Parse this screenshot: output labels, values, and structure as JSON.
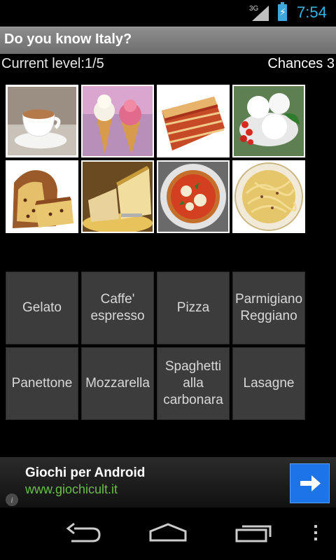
{
  "status_bar": {
    "network": "3G",
    "time": "7:54",
    "battery_icon": "battery-charging-icon",
    "signal_icon": "signal-icon"
  },
  "app": {
    "title": "Do you know Italy?"
  },
  "game": {
    "level_text": "Current level:1/5",
    "chances_text": "Chances 3",
    "images": [
      {
        "name": "espresso-cup-image"
      },
      {
        "name": "gelato-cones-image"
      },
      {
        "name": "lasagne-image"
      },
      {
        "name": "mozzarella-image"
      },
      {
        "name": "panettone-image"
      },
      {
        "name": "parmigiano-image"
      },
      {
        "name": "pizza-image"
      },
      {
        "name": "spaghetti-carbonara-image"
      }
    ],
    "answers": [
      {
        "label": "Gelato"
      },
      {
        "label": "Caffe' espresso"
      },
      {
        "label": "Pizza"
      },
      {
        "label": "Parmigiano Reggiano"
      },
      {
        "label": "Panettone"
      },
      {
        "label": "Mozzarella"
      },
      {
        "label": "Spaghetti alla carbonara"
      },
      {
        "label": "Lasagne"
      }
    ]
  },
  "ad": {
    "title": "Giochi per Android",
    "url": "www.giochicult.it",
    "info_icon": "info-icon",
    "arrow_icon": "arrow-right-icon",
    "accent": "#1c74e8"
  },
  "nav": {
    "back_icon": "back-icon",
    "home_icon": "home-icon",
    "recents_icon": "recent-apps-icon",
    "menu_icon": "overflow-menu-icon"
  }
}
